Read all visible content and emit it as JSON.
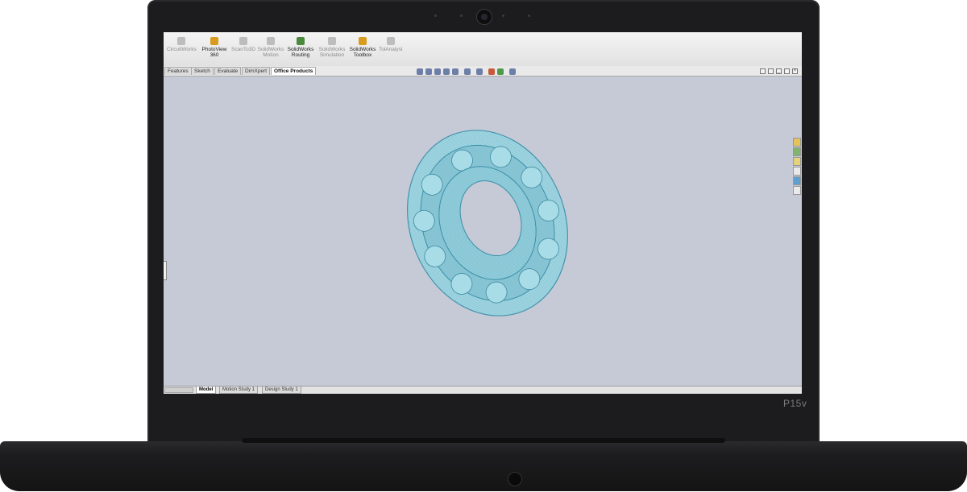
{
  "device": {
    "model_label": "P15v"
  },
  "command_manager": {
    "tools": [
      {
        "label": "CircuitWorks",
        "icon": "circuitworks-icon",
        "active": false
      },
      {
        "label": "PhotoView 360",
        "icon": "photoview-icon",
        "active": true
      },
      {
        "label": "ScanTo3D",
        "icon": "scanto3d-icon",
        "active": false
      },
      {
        "label": "SolidWorks Motion",
        "icon": "motion-icon",
        "active": false
      },
      {
        "label": "SolidWorks Routing",
        "icon": "routing-icon",
        "active": true
      },
      {
        "label": "SolidWorks Simulation",
        "icon": "simulation-icon",
        "active": false
      },
      {
        "label": "SolidWorks Toolbox",
        "icon": "toolbox-icon",
        "active": true
      },
      {
        "label": "TolAnalyst",
        "icon": "tolanalyst-icon",
        "active": false
      }
    ],
    "tabs": [
      "Features",
      "Sketch",
      "Evaluate",
      "DimXpert",
      "Office Products"
    ],
    "active_tab": "Office Products"
  },
  "bottom_tabs": {
    "tabs": [
      "Model",
      "Motion Study 1",
      "Design Study 1"
    ],
    "active_tab": "Model"
  },
  "colors": {
    "viewport_bg": "#c6cad6",
    "bearing_fill": "#8fd0df",
    "bearing_stroke": "#3a8fa8",
    "bezel": "#1c1c1e"
  }
}
